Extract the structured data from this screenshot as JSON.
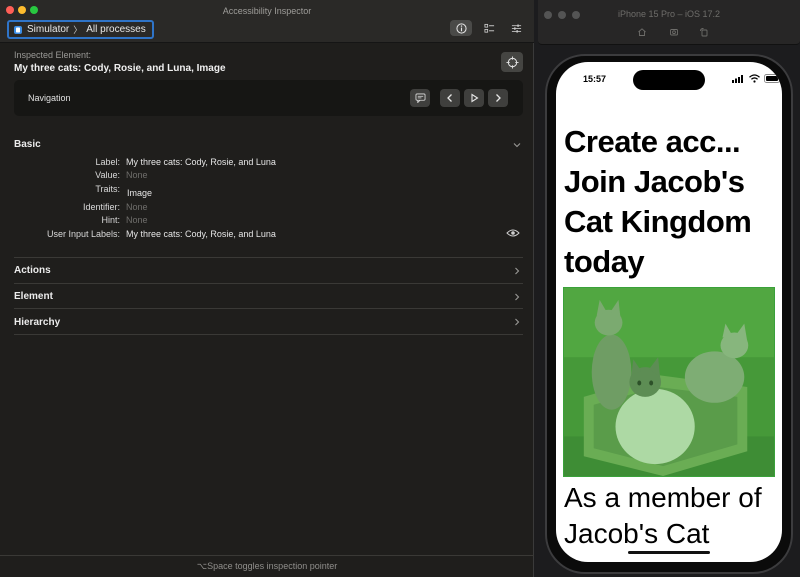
{
  "inspector": {
    "window_title": "Accessibility Inspector",
    "target": {
      "app": "Simulator",
      "process": "All processes"
    },
    "toolbar": {
      "inspect_icon": "info-circle-icon",
      "audit_icon": "checklist-icon",
      "settings_icon": "sliders-icon"
    },
    "inspected": {
      "label": "Inspected Element:",
      "value": "My three cats: Cody, Rosie, and Luna, Image"
    },
    "navigation": {
      "label": "Navigation"
    },
    "sections": {
      "basic": "Basic",
      "actions": "Actions",
      "element": "Element",
      "hierarchy": "Hierarchy"
    },
    "properties": [
      {
        "key": "Label:",
        "value": "My three cats: Cody, Rosie, and Luna",
        "none": false
      },
      {
        "key": "Value:",
        "value": "None",
        "none": true
      },
      {
        "key": "Traits:",
        "value": "Image",
        "none": false
      },
      {
        "key": "Identifier:",
        "value": "None",
        "none": true
      },
      {
        "key": "Hint:",
        "value": "None",
        "none": true
      },
      {
        "key": "User Input Labels:",
        "value": "My three cats: Cody, Rosie, and Luna",
        "none": false
      }
    ],
    "status_hint": "⌥Space toggles inspection pointer",
    "colors": {
      "highlight_border": "#2f74c8",
      "traffic_red": "#ff5f57",
      "traffic_yellow": "#febc2e",
      "traffic_green": "#28c840"
    }
  },
  "simulator": {
    "title": "iPhone 15 Pro – iOS 17.2",
    "tools": [
      "home-icon",
      "screenshot-icon",
      "rotate-icon"
    ],
    "status_time": "15:57",
    "heading": "Create acc... Join Jacob's Cat Kingdom today",
    "body": "As a member of Jacob's Cat",
    "image_alt": "My three cats: Cody, Rosie, and Luna",
    "colors": {
      "highlight_overlay": "#5ac85a"
    }
  }
}
